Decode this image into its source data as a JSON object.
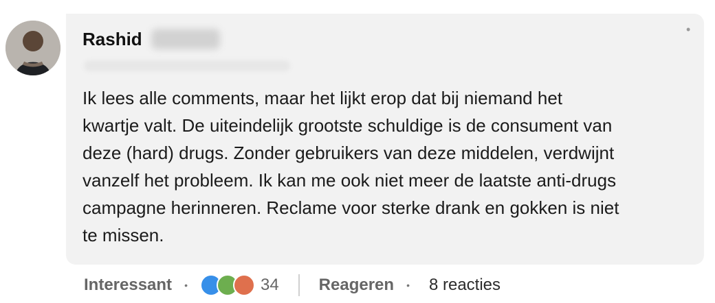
{
  "author": {
    "name": "Rashid"
  },
  "comment": {
    "text": "Ik lees alle comments, maar het lijkt erop dat bij niemand het\nkwartje valt. De uiteindelijk grootste schuldige is de consument van\ndeze (hard) drugs. Zonder gebruikers van deze middelen, verdwijnt\nvanzelf het probleem. Ik kan me ook niet meer de laatste anti-drugs\ncampagne herinneren. Reclame voor sterke drank en gokken is niet\nte missen."
  },
  "actions": {
    "react_label": "Interessant",
    "reaction_count": "34",
    "reply_label": "Reageren",
    "replies_label": "8 reacties"
  },
  "colors": {
    "bubble_bg": "#f2f2f2",
    "reaction_like": "#378fe9",
    "reaction_celebrate": "#6dae4f",
    "reaction_curious": "#df704d"
  },
  "icons": [
    "avatar-photo",
    "more-options-icon",
    "like-reaction-icon",
    "celebrate-reaction-icon",
    "curious-reaction-icon"
  ]
}
